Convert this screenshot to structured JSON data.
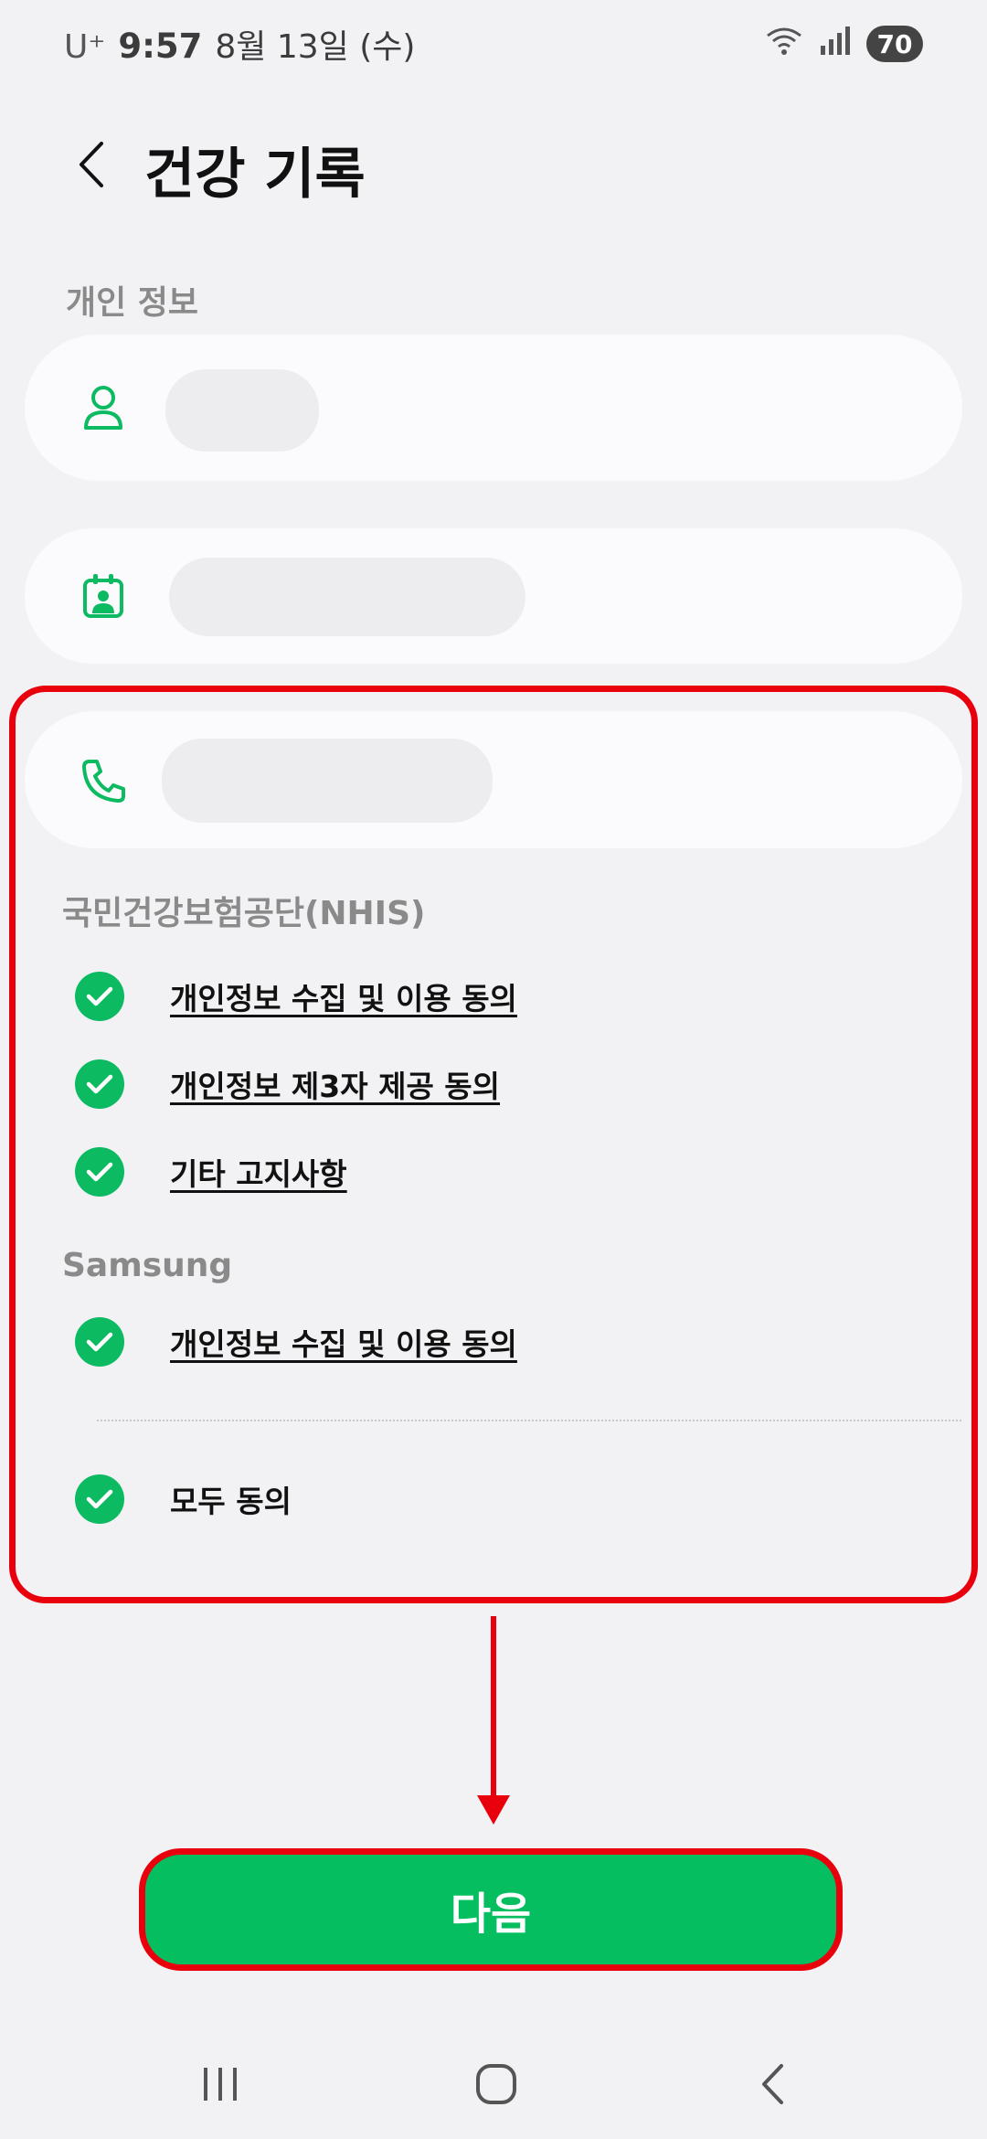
{
  "status_bar": {
    "carrier": "U⁺",
    "time": "9:57",
    "date": "8월 13일 (수)",
    "battery": "70"
  },
  "header": {
    "title": "건강 기록"
  },
  "personal_info": {
    "section_label": "개인 정보"
  },
  "nhis": {
    "section_label": "국민건강보험공단(NHIS)",
    "items": [
      {
        "label": "개인정보 수집 및 이용 동의",
        "checked": true
      },
      {
        "label": "개인정보 제3자 제공 동의",
        "checked": true
      },
      {
        "label": "기타 고지사항",
        "checked": true
      }
    ]
  },
  "samsung": {
    "section_label": "Samsung",
    "items": [
      {
        "label": "개인정보 수집 및 이용 동의",
        "checked": true
      }
    ]
  },
  "agree_all": {
    "label": "모두 동의",
    "checked": true
  },
  "next_button": {
    "label": "다음"
  },
  "colors": {
    "accent_green": "#05be5f",
    "highlight_red": "#e8000d",
    "background": "#f2f2f4"
  }
}
